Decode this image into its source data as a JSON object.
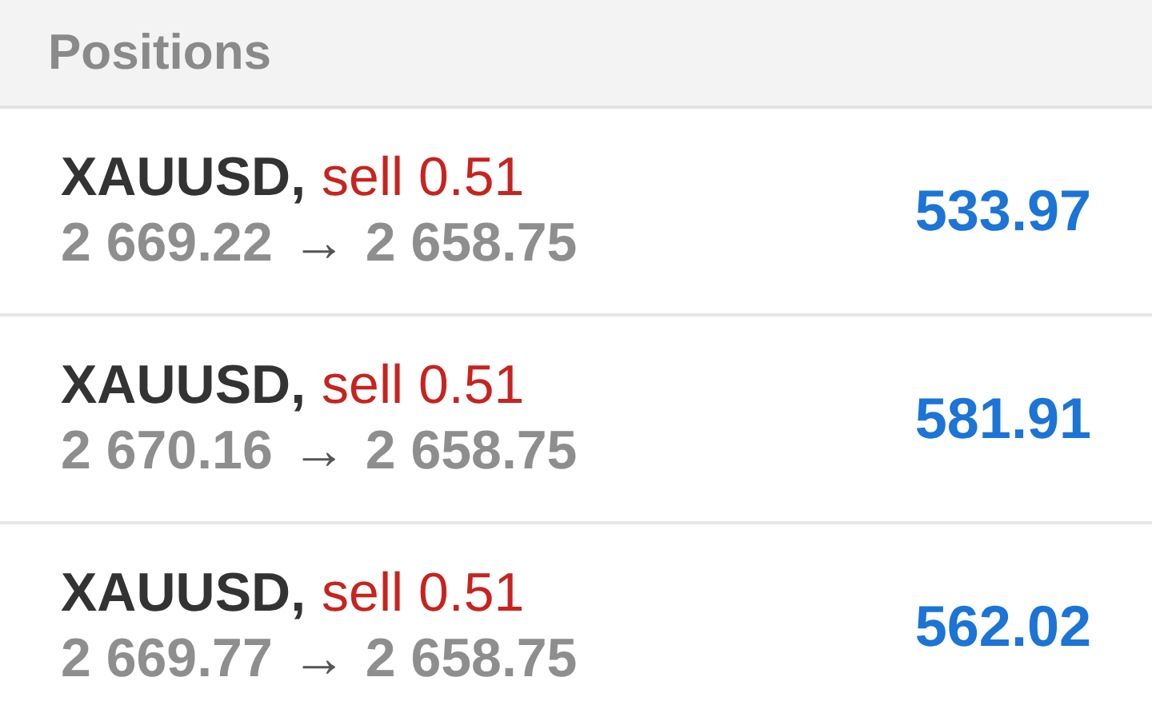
{
  "header": {
    "title": "Positions"
  },
  "positions": [
    {
      "symbol": "XAUUSD,",
      "order": "sell 0.51",
      "open_price": "2 669.22",
      "arrow": "→",
      "current_price": "2 658.75",
      "profit": "533.97"
    },
    {
      "symbol": "XAUUSD,",
      "order": "sell 0.51",
      "open_price": "2 670.16",
      "arrow": "→",
      "current_price": "2 658.75",
      "profit": "581.91"
    },
    {
      "symbol": "XAUUSD,",
      "order": "sell 0.51",
      "open_price": "2 669.77",
      "arrow": "→",
      "current_price": "2 658.75",
      "profit": "562.02"
    }
  ]
}
